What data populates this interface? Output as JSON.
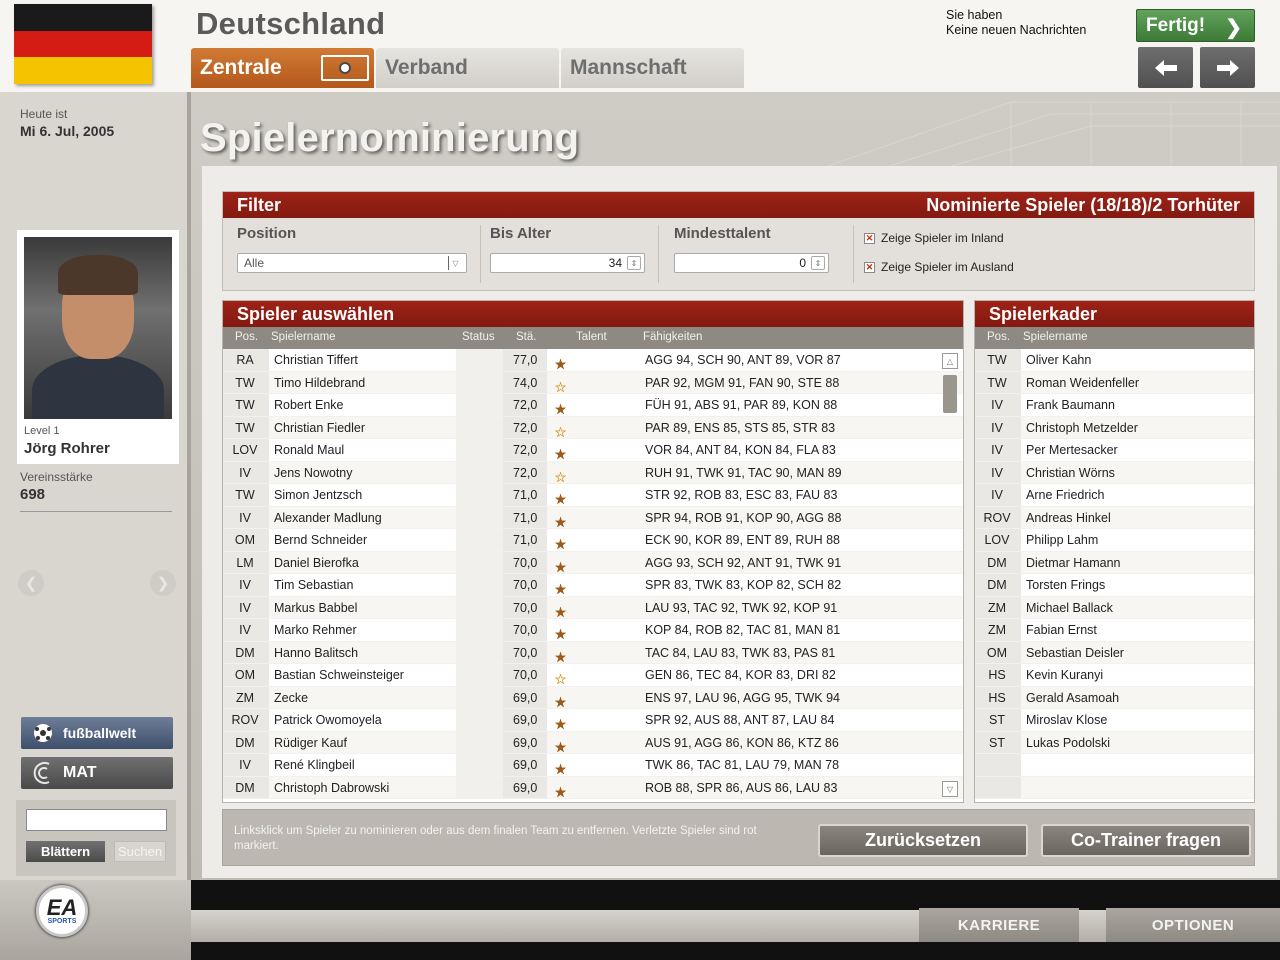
{
  "header": {
    "flag_colors": [
      "#1a1a1a",
      "#d41c14",
      "#f5c400"
    ],
    "country": "Deutschland",
    "tabs": [
      {
        "label": "Zentrale",
        "active": true
      },
      {
        "label": "Verband",
        "active": false
      },
      {
        "label": "Mannschaft",
        "active": false
      }
    ],
    "message_line1": "Sie haben",
    "message_line2": "Keine neuen Nachrichten",
    "done_label": "Fertig!"
  },
  "sidebar": {
    "today_label": "Heute ist",
    "today_date": "Mi 6. Jul, 2005",
    "level": "Level 1",
    "manager_name": "Jörg Rohrer",
    "strength_label": "Vereinsstärke",
    "strength_value": "698",
    "fussballwelt_label": "fußballwelt",
    "mat_label": "MAT",
    "search_value": "",
    "browse_label": "Blättern",
    "search_label": "Suchen"
  },
  "main": {
    "title": "Spielernominierung",
    "filter": {
      "title": "Filter",
      "nominated": "Nominierte Spieler (18/18)/2 Torhüter",
      "position_label": "Position",
      "position_value": "Alle",
      "max_age_label": "Bis Alter",
      "max_age_value": "34",
      "min_talent_label": "Mindesttalent",
      "min_talent_value": "0",
      "checkbox_inland": "Zeige Spieler im Inland",
      "checkbox_ausland": "Zeige Spieler im Ausland"
    },
    "players": {
      "title": "Spieler auswählen",
      "columns": [
        "Pos.",
        "Spielername",
        "Status",
        "Stä.",
        "Talent",
        "Fähigkeiten"
      ],
      "rows": [
        {
          "pos": "RA",
          "name": "Christian Tiffert",
          "status": "",
          "sta": "77,0",
          "talent": 2,
          "skills": "AGG 94, SCH 90, ANT 89, VOR 87"
        },
        {
          "pos": "TW",
          "name": "Timo Hildebrand",
          "status": "",
          "sta": "74,0",
          "talent": 0,
          "skills": "PAR 92, MGM 91, FAN 90, STE 88"
        },
        {
          "pos": "TW",
          "name": "Robert Enke",
          "status": "",
          "sta": "72,0",
          "talent": 1,
          "skills": "FÜH 91, ABS 91, PAR 89, KON 88"
        },
        {
          "pos": "TW",
          "name": "Christian Fiedler",
          "status": "",
          "sta": "72,0",
          "talent": 0,
          "skills": "PAR 89, ENS 85, STS 85, STR 83"
        },
        {
          "pos": "LOV",
          "name": "Ronald Maul",
          "status": "",
          "sta": "72,0",
          "talent": 2,
          "skills": "VOR 84, ANT 84, KON 84, FLA 83"
        },
        {
          "pos": "IV",
          "name": "Jens Nowotny",
          "status": "",
          "sta": "72,0",
          "talent": 0,
          "skills": "RUH 91, TWK 91, TAC 90, MAN 89"
        },
        {
          "pos": "TW",
          "name": "Simon Jentzsch",
          "status": "",
          "sta": "71,0",
          "talent": 1,
          "skills": "STR 92, ROB 83, ESC 83, FAU 83"
        },
        {
          "pos": "IV",
          "name": "Alexander Madlung",
          "status": "",
          "sta": "71,0",
          "talent": 2,
          "skills": "SPR 94, ROB 91, KOP 90, AGG 88"
        },
        {
          "pos": "OM",
          "name": "Bernd Schneider",
          "status": "",
          "sta": "71,0",
          "talent": 1,
          "skills": "ECK 90, KOR 89, ENT 89, RUH 88"
        },
        {
          "pos": "LM",
          "name": "Daniel Bierofka",
          "status": "",
          "sta": "70,0",
          "talent": 1,
          "skills": "AGG 93, SCH 92, ANT 91, TWK 91"
        },
        {
          "pos": "IV",
          "name": "Tim Sebastian",
          "status": "",
          "sta": "70,0",
          "talent": 2,
          "skills": "SPR 83, TWK 83, KOP 82, SCH 82"
        },
        {
          "pos": "IV",
          "name": "Markus Babbel",
          "status": "",
          "sta": "70,0",
          "talent": 1,
          "skills": "LAU 93, TAC 92, TWK 92, KOP 91"
        },
        {
          "pos": "IV",
          "name": "Marko Rehmer",
          "status": "",
          "sta": "70,0",
          "talent": 2,
          "skills": "KOP 84, ROB 82, TAC 81, MAN 81"
        },
        {
          "pos": "DM",
          "name": "Hanno Balitsch",
          "status": "",
          "sta": "70,0",
          "talent": 1,
          "skills": "TAC 84, LAU 83, TWK 83, PAS 81"
        },
        {
          "pos": "OM",
          "name": "Bastian Schweinsteiger",
          "status": "",
          "sta": "70,0",
          "talent": 0,
          "skills": "GEN 86, TEC 84, KOR 83, DRI 82"
        },
        {
          "pos": "ZM",
          "name": "Zecke",
          "status": "",
          "sta": "69,0",
          "talent": 2,
          "skills": "ENS 97, LAU 96, AGG 95, TWK 94"
        },
        {
          "pos": "ROV",
          "name": "Patrick Owomoyela",
          "status": "",
          "sta": "69,0",
          "talent": 1,
          "skills": "SPR 92, AUS 88, ANT 87, LAU 84"
        },
        {
          "pos": "DM",
          "name": "Rüdiger Kauf",
          "status": "",
          "sta": "69,0",
          "talent": 2,
          "skills": "AUS 91, AGG 86, KON 86, KTZ 86"
        },
        {
          "pos": "IV",
          "name": "René Klingbeil",
          "status": "",
          "sta": "69,0",
          "talent": 2,
          "skills": "TWK 86, TAC 81, LAU 79, MAN 78"
        },
        {
          "pos": "DM",
          "name": "Christoph Dabrowski",
          "status": "",
          "sta": "69,0",
          "talent": 2,
          "skills": "ROB 88, SPR 86, AUS 86, LAU 83"
        }
      ]
    },
    "squad": {
      "title": "Spielerkader",
      "columns": [
        "Pos.",
        "Spielername"
      ],
      "rows": [
        {
          "pos": "TW",
          "name": "Oliver Kahn"
        },
        {
          "pos": "TW",
          "name": "Roman Weidenfeller"
        },
        {
          "pos": "IV",
          "name": "Frank Baumann"
        },
        {
          "pos": "IV",
          "name": "Christoph Metzelder"
        },
        {
          "pos": "IV",
          "name": "Per Mertesacker"
        },
        {
          "pos": "IV",
          "name": "Christian Wörns"
        },
        {
          "pos": "IV",
          "name": "Arne Friedrich"
        },
        {
          "pos": "ROV",
          "name": "Andreas Hinkel"
        },
        {
          "pos": "LOV",
          "name": "Philipp Lahm"
        },
        {
          "pos": "DM",
          "name": "Dietmar Hamann"
        },
        {
          "pos": "DM",
          "name": "Torsten Frings"
        },
        {
          "pos": "ZM",
          "name": "Michael Ballack"
        },
        {
          "pos": "ZM",
          "name": "Fabian Ernst"
        },
        {
          "pos": "OM",
          "name": "Sebastian Deisler"
        },
        {
          "pos": "HS",
          "name": "Kevin Kuranyi"
        },
        {
          "pos": "HS",
          "name": "Gerald Asamoah"
        },
        {
          "pos": "ST",
          "name": "Miroslav Klose"
        },
        {
          "pos": "ST",
          "name": "Lukas Podolski"
        },
        {
          "pos": "",
          "name": ""
        },
        {
          "pos": "",
          "name": ""
        }
      ]
    },
    "hint": "Linksklick um Spieler zu nominieren oder aus dem finalen Team zu entfernen. Verletzte Spieler sind rot markiert.",
    "reset_label": "Zurücksetzen",
    "cotrainer_label": "Co-Trainer fragen"
  },
  "bottom": {
    "logo_text": "EA",
    "logo_sub": "SPORTS",
    "karriere_label": "KARRIERE",
    "optionen_label": "OPTIONEN"
  }
}
